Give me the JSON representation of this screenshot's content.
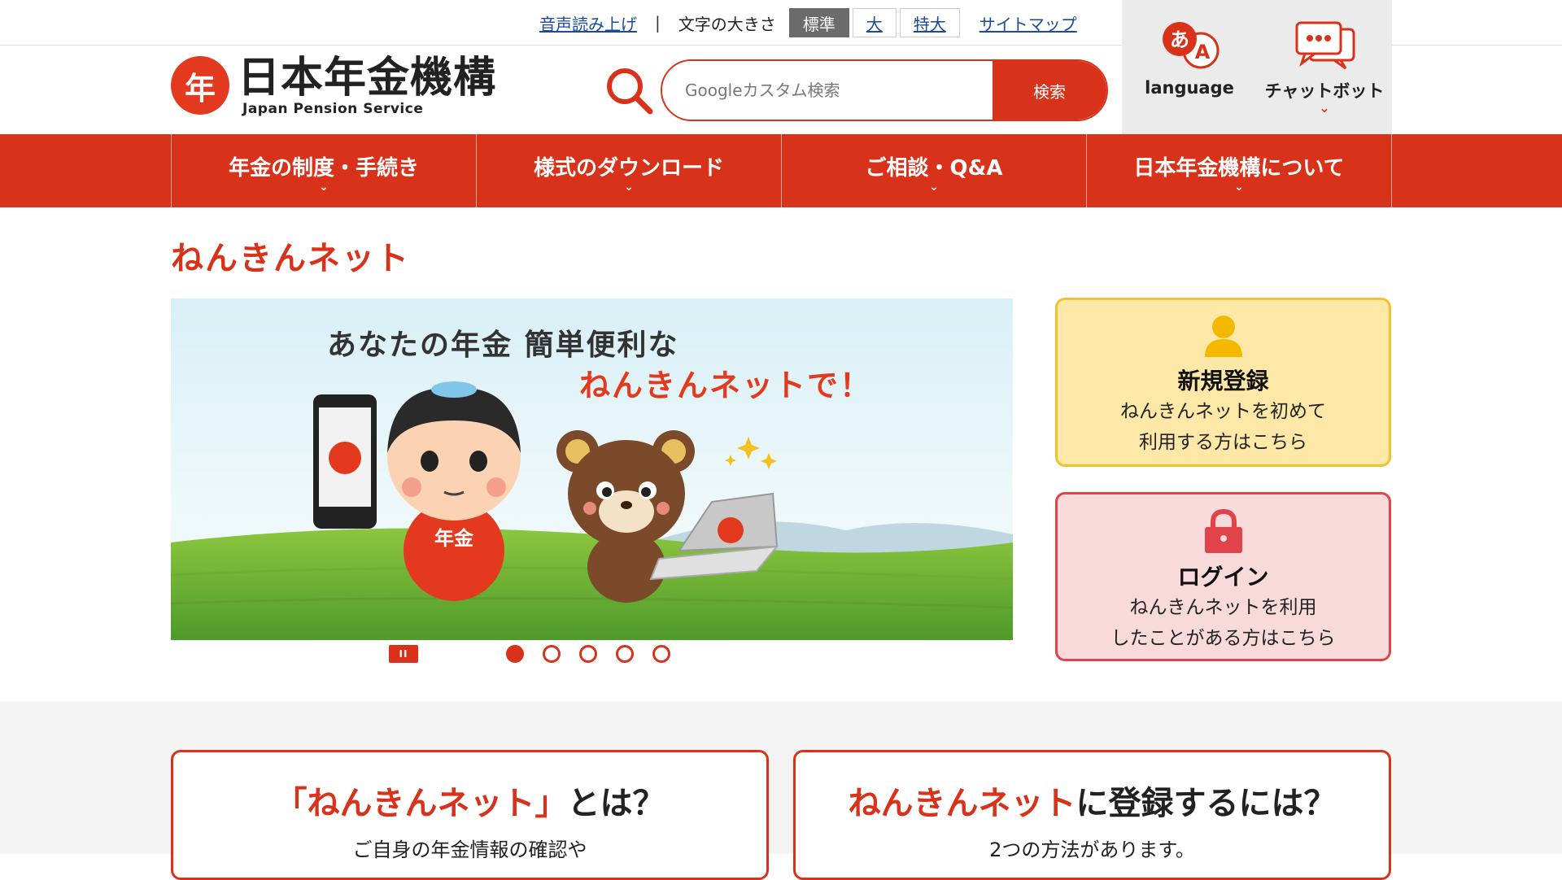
{
  "utility": {
    "read_aloud": "音声読み上げ",
    "separator": "|",
    "font_size_label": "文字の大きさ",
    "font_sizes": [
      "標準",
      "大",
      "特大"
    ],
    "sitemap": "サイトマップ"
  },
  "side_buttons": {
    "language_glyph_a": "あ",
    "language_glyph_b": "A",
    "language": "language",
    "chatbot": "チャットボット",
    "chevron": "⌄"
  },
  "logo": {
    "mark": "年",
    "name": "日本年金機構",
    "english": "Japan Pension Service"
  },
  "search": {
    "placeholder": "Googleカスタム検索",
    "button": "検索"
  },
  "nav": {
    "items": [
      "年金の制度・手続き",
      "様式のダウンロード",
      "ご相談・Q&A",
      "日本年金機構について"
    ],
    "chevron": "⌄"
  },
  "page_title": "ねんきんネット",
  "banner": {
    "line1": "あなたの年金 簡単便利な",
    "line2": "ねんきんネットで！",
    "mascot_label": "年金",
    "pause": "II"
  },
  "cards": {
    "register": {
      "title": "新規登録",
      "desc1": "ねんきんネットを初めて",
      "desc2": "利用する方はこちら"
    },
    "login": {
      "title": "ログイン",
      "desc1": "ねんきんネットを利用",
      "desc2": "したことがある方はこちら"
    }
  },
  "info": {
    "left_title_red": "「ねんきんネット」",
    "left_title_black": "とは？",
    "left_sub": "ご自身の年金情報の確認や",
    "right_title_red": "ねんきんネット",
    "right_title_black": "に登録するには？",
    "right_sub": "2つの方法があります。"
  },
  "colors": {
    "brand_red": "#d8321a",
    "register_bg": "#fde8a8",
    "login_bg": "#f9dada"
  }
}
